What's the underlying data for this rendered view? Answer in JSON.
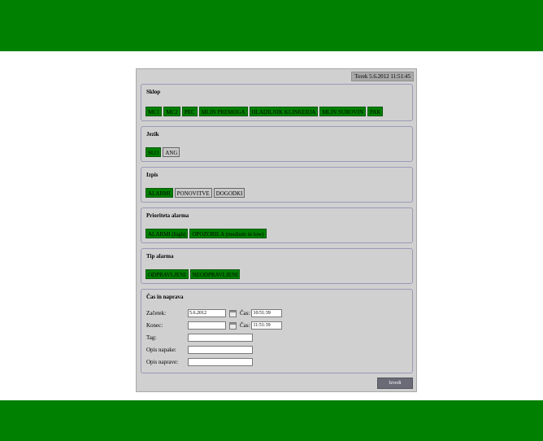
{
  "datetime": "Torek 5.6.2012 11:51:45",
  "sklop": {
    "title": "Sklop",
    "buttons": [
      {
        "label": "MC1",
        "active": true
      },
      {
        "label": "MC2",
        "active": true
      },
      {
        "label": "PEC",
        "active": true
      },
      {
        "label": "MLIN PREMOGA",
        "active": true
      },
      {
        "label": "HLADILNIK KLINKERJA",
        "active": true
      },
      {
        "label": "MLIN SUROVIN",
        "active": true
      },
      {
        "label": "PAK",
        "active": true
      }
    ]
  },
  "jezik": {
    "title": "Jezik",
    "buttons": [
      {
        "label": "SLO",
        "active": true
      },
      {
        "label": "ANG",
        "active": false
      }
    ]
  },
  "izpis": {
    "title": "Izpis",
    "buttons": [
      {
        "label": "ALARMI",
        "active": true
      },
      {
        "label": "PONOVITVE",
        "active": false
      },
      {
        "label": "DOGODKI",
        "active": false
      }
    ]
  },
  "prioriteta": {
    "title": "Prioriteta alarma",
    "buttons": [
      {
        "label": "ALARMI (high)",
        "active": true
      },
      {
        "label": "OPOZORILA (medium in low)",
        "active": true
      }
    ]
  },
  "tip": {
    "title": "Tip alarma",
    "buttons": [
      {
        "label": "ODPRAVLJENI",
        "active": true
      },
      {
        "label": "NEODPRAVLJENI",
        "active": true
      }
    ]
  },
  "cas": {
    "title": "Čas in naprava",
    "zacetek_label": "Začetek:",
    "zacetek_value": "5.6.2012",
    "konec_label": "Konec:",
    "konec_value": "",
    "cas_label": "Čas:",
    "zacetek_cas": "10:51:39",
    "konec_cas": "11:51:39",
    "tag_label": "Tag:",
    "tag_value": "",
    "opis_napake_label": "Opis napake:",
    "opis_napake_value": "",
    "opis_naprave_label": "Opis naprave:",
    "opis_naprave_value": ""
  },
  "izvedi_label": "Izvedi",
  "colors": {
    "accent_green": "#008000",
    "panel": "#d0d0d0",
    "button_off": "#c8c8c8",
    "izvedi": "#6b6b78"
  }
}
